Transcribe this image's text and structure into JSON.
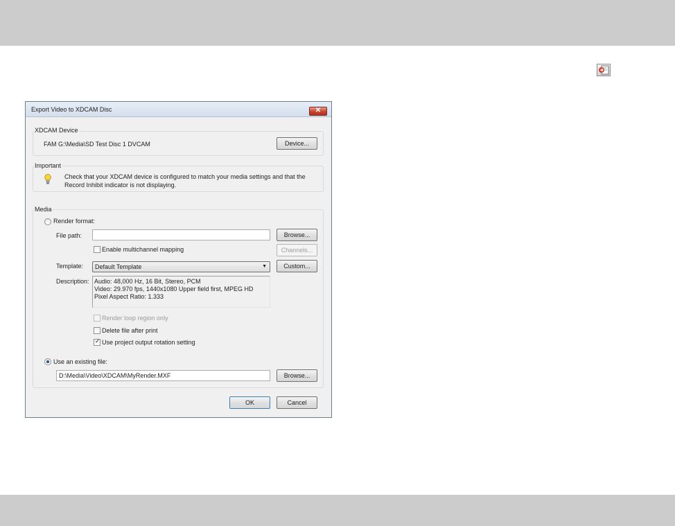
{
  "dialog": {
    "title": "Export Video to XDCAM Disc",
    "close_label": "✕"
  },
  "xdcam_device": {
    "group_label": "XDCAM Device",
    "device_name": "FAM G:\\Media\\SD Test Disc 1 DVCAM",
    "device_button": "Device..."
  },
  "important": {
    "group_label": "Important",
    "line1": "Check that your XDCAM device is configured to match your media settings and that the",
    "line2": "Record Inhibit indicator is not displaying."
  },
  "media": {
    "group_label": "Media",
    "render_format_label": "Render format:",
    "render_format_selected": false,
    "file_path_label": "File path:",
    "file_path_value": "",
    "browse_button": "Browse...",
    "enable_multichannel_label": "Enable multichannel mapping",
    "enable_multichannel_checked": false,
    "channels_button": "Channels...",
    "template_label": "Template:",
    "template_value": "Default Template",
    "custom_button": "Custom...",
    "description_label": "Description:",
    "description_lines": [
      "Audio: 48,000 Hz, 16 Bit, Stereo, PCM",
      "Video: 29.970 fps, 1440x1080 Upper field first, MPEG HD",
      "Pixel Aspect Ratio: 1.333"
    ],
    "render_loop_label": "Render loop region only",
    "render_loop_checked": false,
    "delete_after_print_label": "Delete file after print",
    "delete_after_print_checked": false,
    "use_rotation_label": "Use project output rotation setting",
    "use_rotation_checked": true,
    "use_existing_label": "Use an existing file:",
    "use_existing_selected": true,
    "existing_file_value": "D:\\Media\\Video\\XDCAM\\MyRender.MXF",
    "browse_button_2": "Browse..."
  },
  "footer": {
    "ok_button": "OK",
    "cancel_button": "Cancel"
  },
  "colors": {
    "band": "#cccccc",
    "dialog_bg": "#f0f0f0",
    "close_red": "#c7432e"
  },
  "icons": [
    "document-export-icon",
    "close-icon",
    "lightbulb-icon",
    "dropdown-arrow-icon",
    "checkmark-icon"
  ]
}
